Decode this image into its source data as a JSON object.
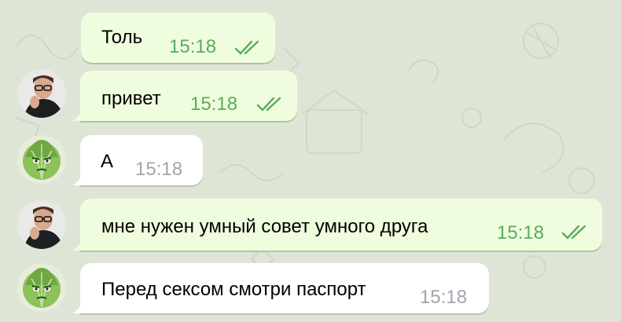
{
  "chat": {
    "colors": {
      "background": "#dfe5d6",
      "outgoing_bubble": "#effdde",
      "incoming_bubble": "#ffffff",
      "outgoing_time": "#5aac5f",
      "incoming_time": "#a0a6ac"
    },
    "messages": [
      {
        "text": "Толь",
        "time": "15:18",
        "outgoing": true,
        "status_icon": "double-check-icon"
      },
      {
        "text": "привет",
        "time": "15:18",
        "outgoing": true,
        "status_icon": "double-check-icon",
        "avatar": "man-glasses-avatar"
      },
      {
        "text": "А",
        "time": "15:18",
        "outgoing": false,
        "avatar": "cabbage-avatar"
      },
      {
        "text": "мне нужен умный совет умного друга",
        "time": "15:18",
        "outgoing": true,
        "status_icon": "double-check-icon",
        "avatar": "man-glasses-avatar"
      },
      {
        "text": "Перед сексом смотри паспорт",
        "time": "15:18",
        "outgoing": false,
        "avatar": "cabbage-avatar"
      }
    ]
  }
}
